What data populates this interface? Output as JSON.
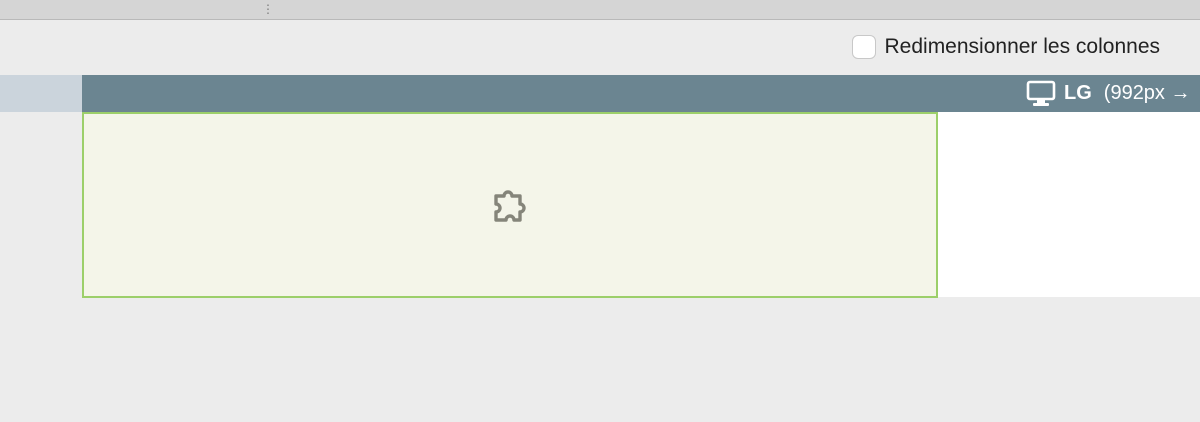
{
  "splitter": {
    "handle_glyph": "⋮"
  },
  "toolbar": {
    "resize_columns_label": "Redimensionner les colonnes",
    "resize_columns_checked": false
  },
  "breakpoint": {
    "icon": "monitor-icon",
    "name": "LG",
    "range": "(992px →"
  },
  "canvas": {
    "column": {
      "icon": "puzzle-icon",
      "border_color": "#9ccf6a",
      "fill_color": "#f4f5e9"
    }
  },
  "colors": {
    "breakpoint_bar": "#6b8591",
    "ruler": "#cbd4dc",
    "background": "#ececec"
  }
}
